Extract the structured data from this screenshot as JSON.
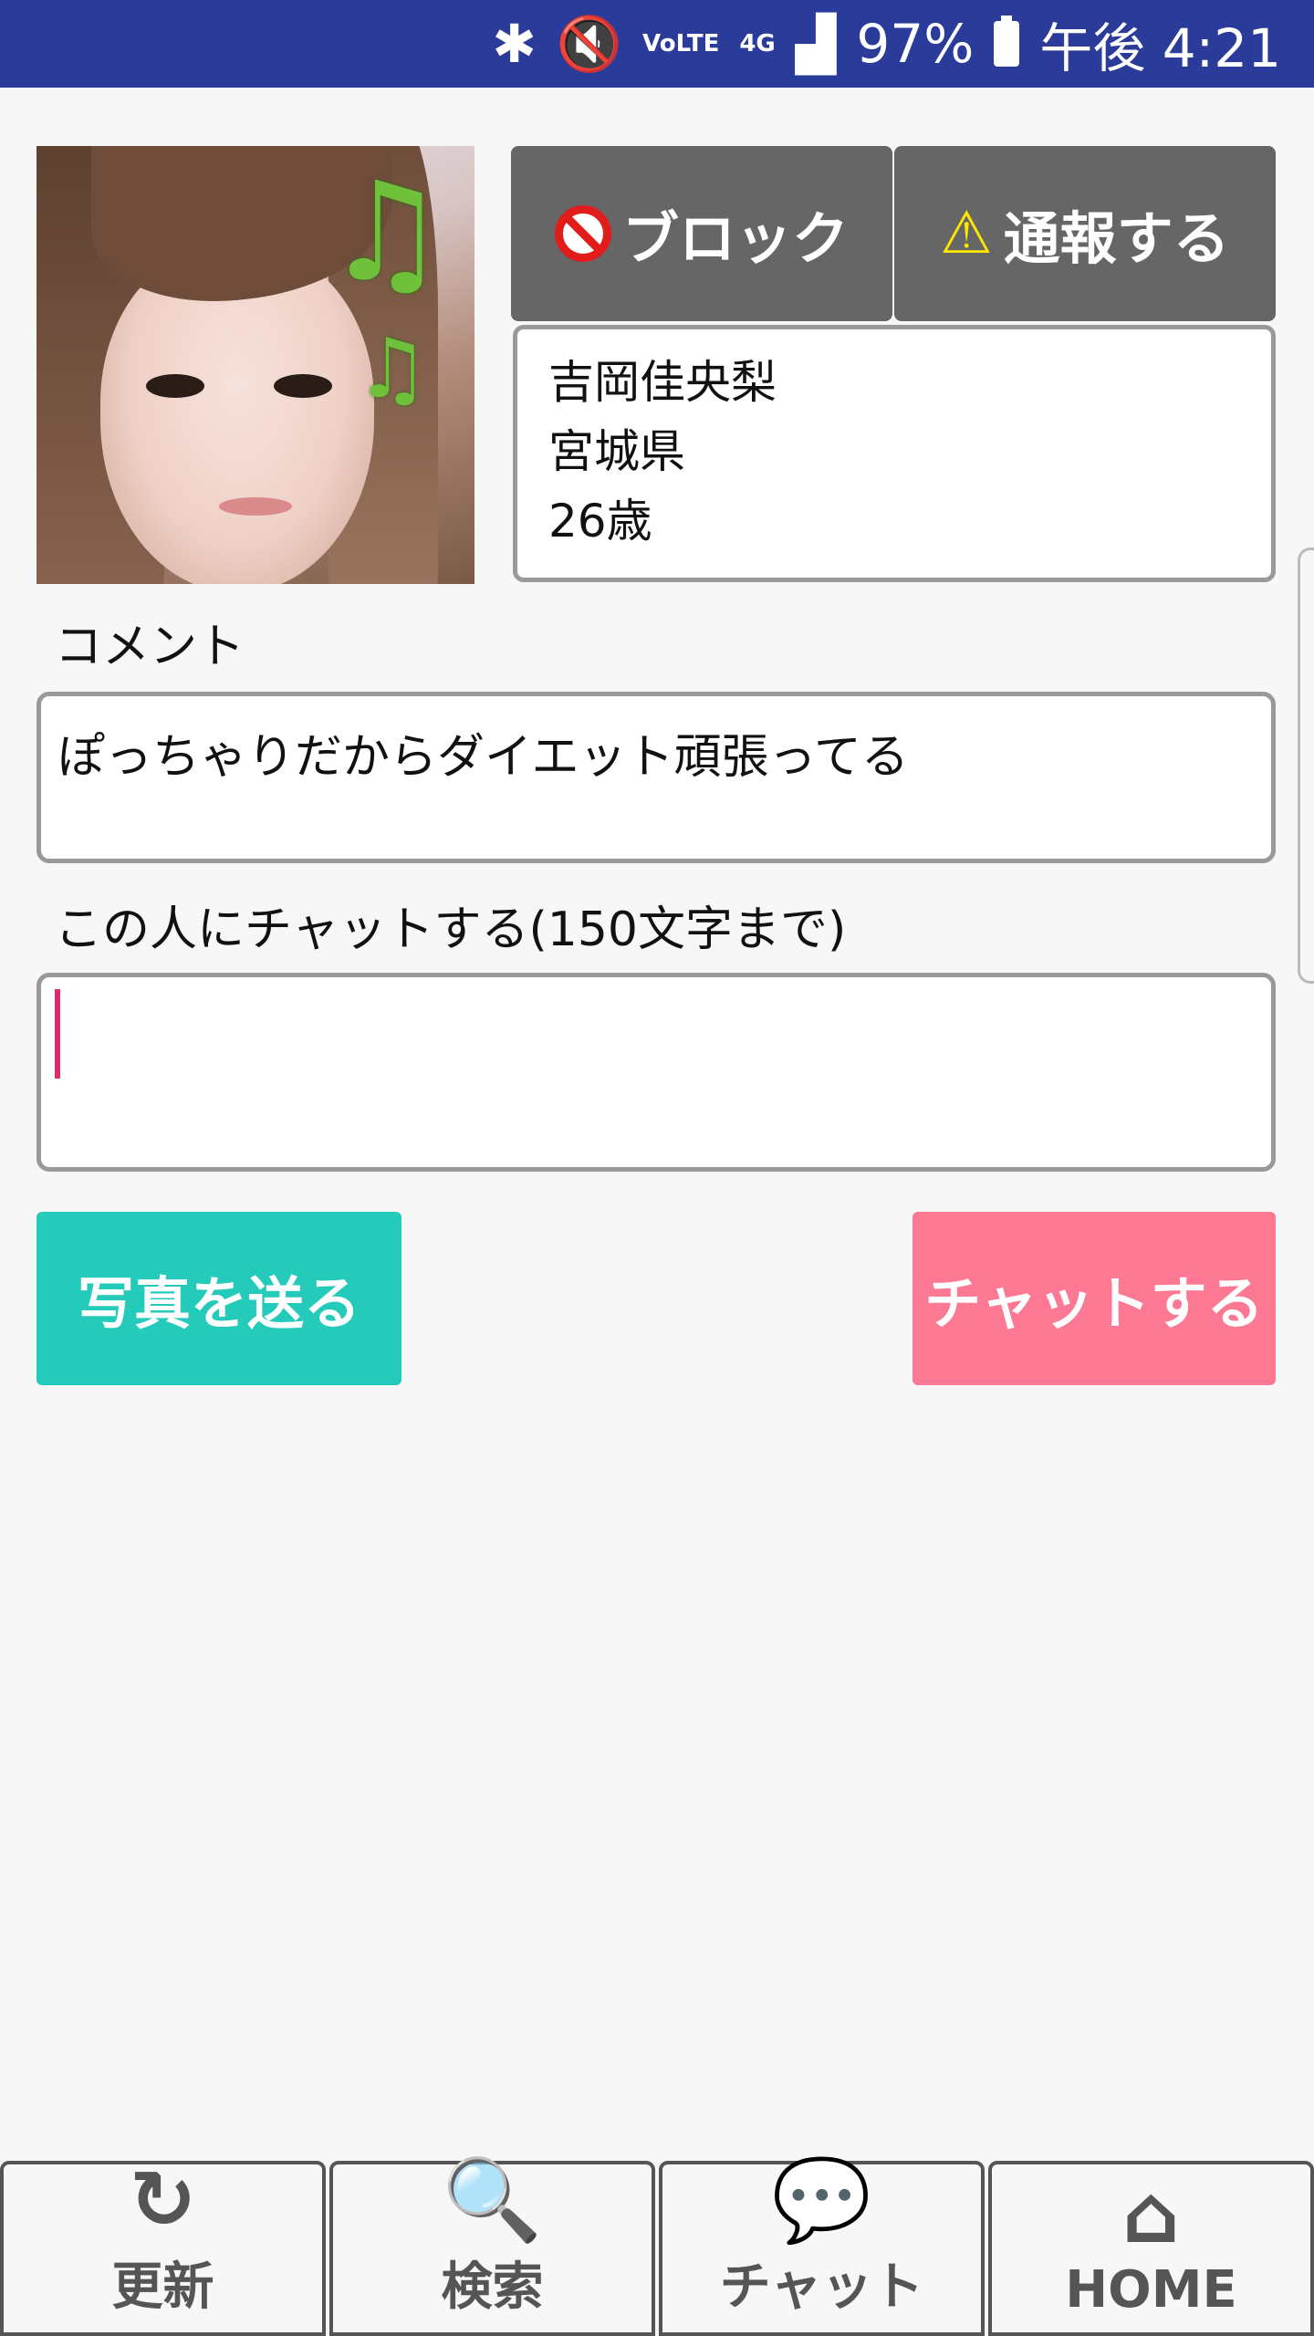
{
  "status_bar": {
    "bluetooth_icon": "bluetooth-icon",
    "mute_icon": "vibrate-mute-icon",
    "volte_label": "VoLTE",
    "network_label": "4G",
    "battery_percent": "97%",
    "time": "午後 4:21"
  },
  "profile": {
    "name": "吉岡佳央梨",
    "prefecture": "宮城県",
    "age": "26歳"
  },
  "actions": {
    "block_label": "ブロック",
    "report_label": "通報する"
  },
  "comment": {
    "label": "コメント",
    "text": "ぽっちゃりだからダイエット頑張ってる"
  },
  "chat": {
    "label": "この人にチャットする(150文字まで)",
    "input_value": "",
    "send_photo_label": "写真を送る",
    "send_chat_label": "チャットする"
  },
  "nav": {
    "items": [
      {
        "label": "更新",
        "icon": "refresh-icon"
      },
      {
        "label": "検索",
        "icon": "search-icon"
      },
      {
        "label": "チャット",
        "icon": "chat-bubbles-icon"
      },
      {
        "label": "HOME",
        "icon": "home-icon"
      }
    ]
  },
  "colors": {
    "status_bar": "#2b3b9a",
    "dark_button": "#666666",
    "photo_button": "#24cbbb",
    "chat_button": "#fc7893",
    "cursor": "#e2286e"
  }
}
